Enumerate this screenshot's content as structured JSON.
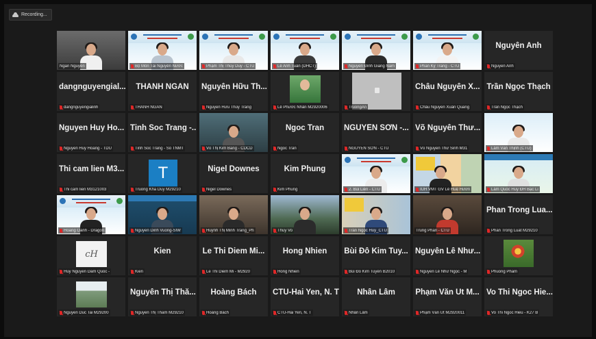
{
  "recording": {
    "label": "Recording..."
  },
  "colors": {
    "mic_muted": "#e02828",
    "active_border": "#b9d84e",
    "avatar_t": "#1b7fc4"
  },
  "participants": [
    {
      "big": "",
      "label": "Ngan Nguyen",
      "muted": false
    },
    {
      "big": "",
      "label": "Bộ Môn Tài Nguyên Nước",
      "muted": true
    },
    {
      "big": "",
      "label": "Phạm Thị Thúy Duy - CTU",
      "muted": true
    },
    {
      "big": "",
      "label": "Lê Anh Tuấn (DHCT)",
      "muted": true
    },
    {
      "big": "",
      "label": "Nguyễn Đình Giang Nam",
      "muted": true
    },
    {
      "big": "",
      "label": "Phan Kỳ Trang - CTU",
      "muted": true
    },
    {
      "big": "Nguyễn Anh",
      "label": "Nguyễn Anh",
      "muted": true
    },
    {
      "big": "dangnguyengial...",
      "label": "dangnguyengialinh",
      "muted": true
    },
    {
      "big": "THANH NGAN",
      "label": "THANH NGAN",
      "muted": true
    },
    {
      "big": "Nguyễn Hữu Th...",
      "label": "Nguyễn Hữu Thùy Trang",
      "muted": true
    },
    {
      "big": "",
      "label": "Lê Phước Nhân M2920006",
      "muted": true
    },
    {
      "big": "",
      "label": "TruongAn",
      "muted": true
    },
    {
      "big": "Châu Nguyễn X...",
      "label": "Châu Nguyễn Xuân Quang",
      "muted": true
    },
    {
      "big": "Trần Ngọc Thạch",
      "label": "Trần Ngọc Thạch",
      "muted": true
    },
    {
      "big": "Nguyen Huy Ho...",
      "label": "Nguyen Huy Hoang - TDU",
      "muted": true
    },
    {
      "big": "Tinh Soc Trang -...",
      "label": "Tinh Soc Trang - So TNMT",
      "muted": true
    },
    {
      "big": "",
      "label": "Võ Thị Kim Bằng - CDCD",
      "muted": true
    },
    {
      "big": "Ngoc Tran",
      "label": "Ngoc Tran",
      "muted": true
    },
    {
      "big": "NGUYỄN SƠN -...",
      "label": "NGUYỄN SƠN - CTU",
      "muted": true
    },
    {
      "big": "Võ Nguyễn Thư...",
      "label": "Võ Nguyễn Thư Sinh M31",
      "muted": true
    },
    {
      "big": "",
      "label": "Lâm Văn Thịnh (CTU)",
      "muted": true
    },
    {
      "big": "Thi cam lien M3...",
      "label": "Thi cam lien M3121003",
      "muted": true
    },
    {
      "big": "",
      "label": "Truong Kha Duy M29210",
      "muted": true
    },
    {
      "big": "Nigel Downes",
      "label": "Nigel Downes",
      "muted": true
    },
    {
      "big": "Kim Phung",
      "label": "Kim Phung",
      "muted": true
    },
    {
      "big": "",
      "label": "2. Bùi Liên - CTU",
      "muted": true
    },
    {
      "big": "",
      "label": "IUH VMT GV Lê Huệ Hươn",
      "muted": true
    },
    {
      "big": "",
      "label": "Lâm Quốc Huy ĐH Bạc Li",
      "muted": true
    },
    {
      "big": "",
      "label": "Hoang Oanh - Dragon",
      "muted": true
    },
    {
      "big": "",
      "label": "Nguyen Dinh Vuong-SIW",
      "muted": true
    },
    {
      "big": "",
      "label": "Huỳnh Thị Minh Trang_Ph",
      "muted": true
    },
    {
      "big": "",
      "label": "Thuy Vo",
      "muted": true
    },
    {
      "big": "",
      "label": "Trần Ngọc Huy_CTU",
      "muted": true
    },
    {
      "big": "",
      "label": "Trung Phan - CTU",
      "muted": false
    },
    {
      "big": "Phan Trong Lua...",
      "label": "Phan Trong Luat M29210",
      "muted": true
    },
    {
      "big": "",
      "label": "Huy Nguyen Dam Quoc -",
      "muted": true
    },
    {
      "big": "Kien",
      "label": "Kien",
      "muted": true
    },
    {
      "big": "Le Thi Diem Mi...",
      "label": "Le Thi Diem Mi - M2920",
      "muted": true
    },
    {
      "big": "Hong Nhien",
      "label": "Hong Nhien",
      "muted": true
    },
    {
      "big": "Bùi Đỗ Kim Tuy...",
      "label": "Bùi Đỗ Kim Tuyền B2010",
      "muted": true
    },
    {
      "big": "Nguyễn Lê Như...",
      "label": "Nguyễn Lê Như Ngọc - M",
      "muted": true
    },
    {
      "big": "",
      "label": "Phuong Pham",
      "muted": true
    },
    {
      "big": "",
      "label": "Nguyen Duc Tai M29200",
      "muted": true
    },
    {
      "big": "Nguyễn Thị Thắ...",
      "label": "Nguyễn Thị Thắm M29210",
      "muted": true
    },
    {
      "big": "Hoàng Bách",
      "label": "Hoàng Bách",
      "muted": true
    },
    {
      "big": "CTU-Hai Yen, N. T",
      "label": "CTU-Hai Yen, N. T",
      "muted": true
    },
    {
      "big": "Nhân Lâm",
      "label": "Nhân Lâm",
      "muted": true
    },
    {
      "big": "Phạm Văn Út M...",
      "label": "Phạm Văn Út M2920011",
      "muted": true
    },
    {
      "big": "Vo Thi Ngoc Hie...",
      "label": "Vo Thi Ngoc Hieu - K27 B",
      "muted": true
    }
  ],
  "avatars": {
    "t_letter": "T",
    "signature": "cH"
  }
}
